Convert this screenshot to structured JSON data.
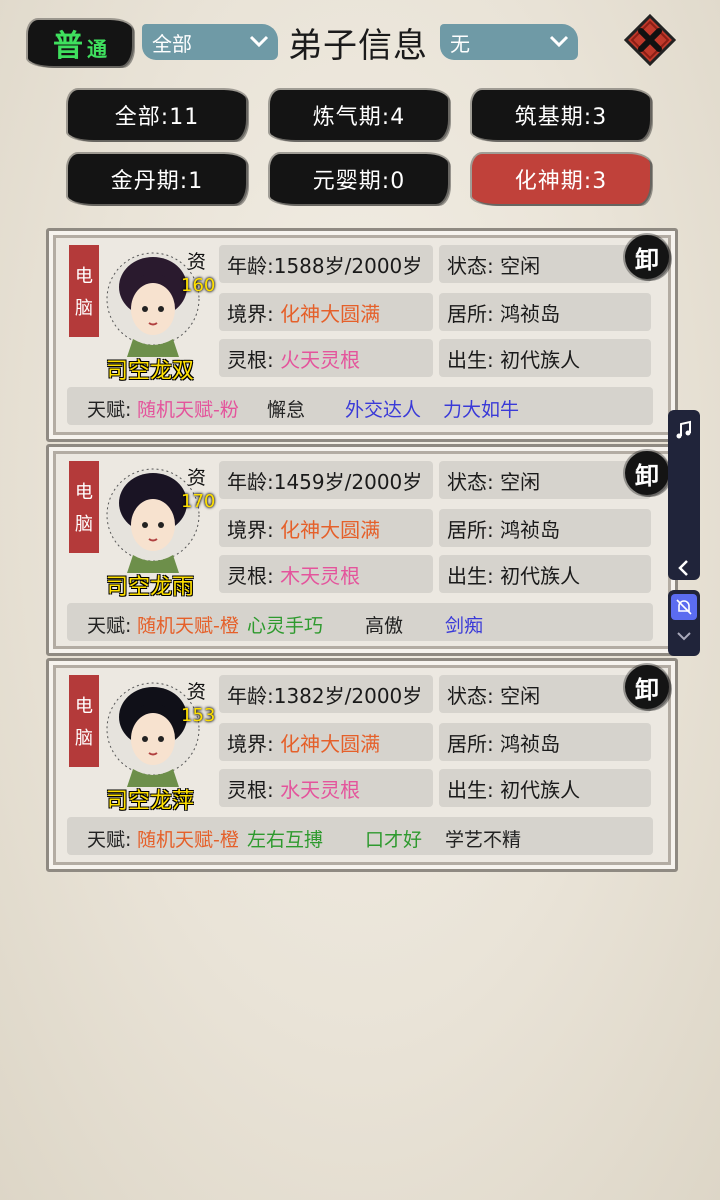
{
  "header": {
    "mode_big": "普",
    "mode_small": "通",
    "filter_select": "全部",
    "title": "弟子信息",
    "sort_select": "无"
  },
  "tabs": [
    {
      "label": "全部:11",
      "active": false
    },
    {
      "label": "炼气期:4",
      "active": false
    },
    {
      "label": "筑基期:3",
      "active": false
    },
    {
      "label": "金丹期:1",
      "active": false
    },
    {
      "label": "元婴期:0",
      "active": false
    },
    {
      "label": "化神期:3",
      "active": true
    }
  ],
  "labels": {
    "type_line1": "电",
    "type_line2": "脑",
    "zi": "资",
    "seal": "卸"
  },
  "disciples": [
    {
      "zi_value": "160",
      "name": "司空龙双",
      "age": "年龄:1588岁/2000岁",
      "status": "状态: 空闲",
      "realm_label": "境界:",
      "realm": "化神大圆满",
      "residence": "居所: 鸿祯岛",
      "root_label": "灵根:",
      "root": "火天灵根",
      "birth": "出生: 初代族人",
      "talent_label": "天赋:",
      "talents": [
        {
          "text": "随机天赋-粉",
          "color": "#e4549c"
        },
        {
          "text": "懈怠",
          "color": "#222222"
        },
        {
          "text": "外交达人",
          "color": "#3a3ad8"
        },
        {
          "text": "力大如牛",
          "color": "#3a3ad8"
        }
      ]
    },
    {
      "zi_value": "170",
      "name": "司空龙雨",
      "age": "年龄:1459岁/2000岁",
      "status": "状态: 空闲",
      "realm_label": "境界:",
      "realm": "化神大圆满",
      "residence": "居所: 鸿祯岛",
      "root_label": "灵根:",
      "root": "木天灵根",
      "birth": "出生: 初代族人",
      "talent_label": "天赋:",
      "talents": [
        {
          "text": "随机天赋-橙",
          "color": "#e5602a"
        },
        {
          "text": "心灵手巧",
          "color": "#2e9a2e"
        },
        {
          "text": "高傲",
          "color": "#222222"
        },
        {
          "text": "剑痴",
          "color": "#3a3ad8"
        }
      ]
    },
    {
      "zi_value": "153",
      "name": "司空龙萍",
      "age": "年龄:1382岁/2000岁",
      "status": "状态: 空闲",
      "realm_label": "境界:",
      "realm": "化神大圆满",
      "residence": "居所: 鸿祯岛",
      "root_label": "灵根:",
      "root": "水天灵根",
      "birth": "出生: 初代族人",
      "talent_label": "天赋:",
      "talents": [
        {
          "text": "随机天赋-橙",
          "color": "#e5602a"
        },
        {
          "text": "左右互搏",
          "color": "#2e9a2e"
        },
        {
          "text": "口才好",
          "color": "#2e9a2e"
        },
        {
          "text": "学艺不精",
          "color": "#222222"
        }
      ]
    }
  ],
  "colors": {
    "active_tab": "#c0413a",
    "select_bg": "#6f9aa6",
    "name": "#ffe000",
    "realm": "#e5602a",
    "root": "#e4549c"
  }
}
